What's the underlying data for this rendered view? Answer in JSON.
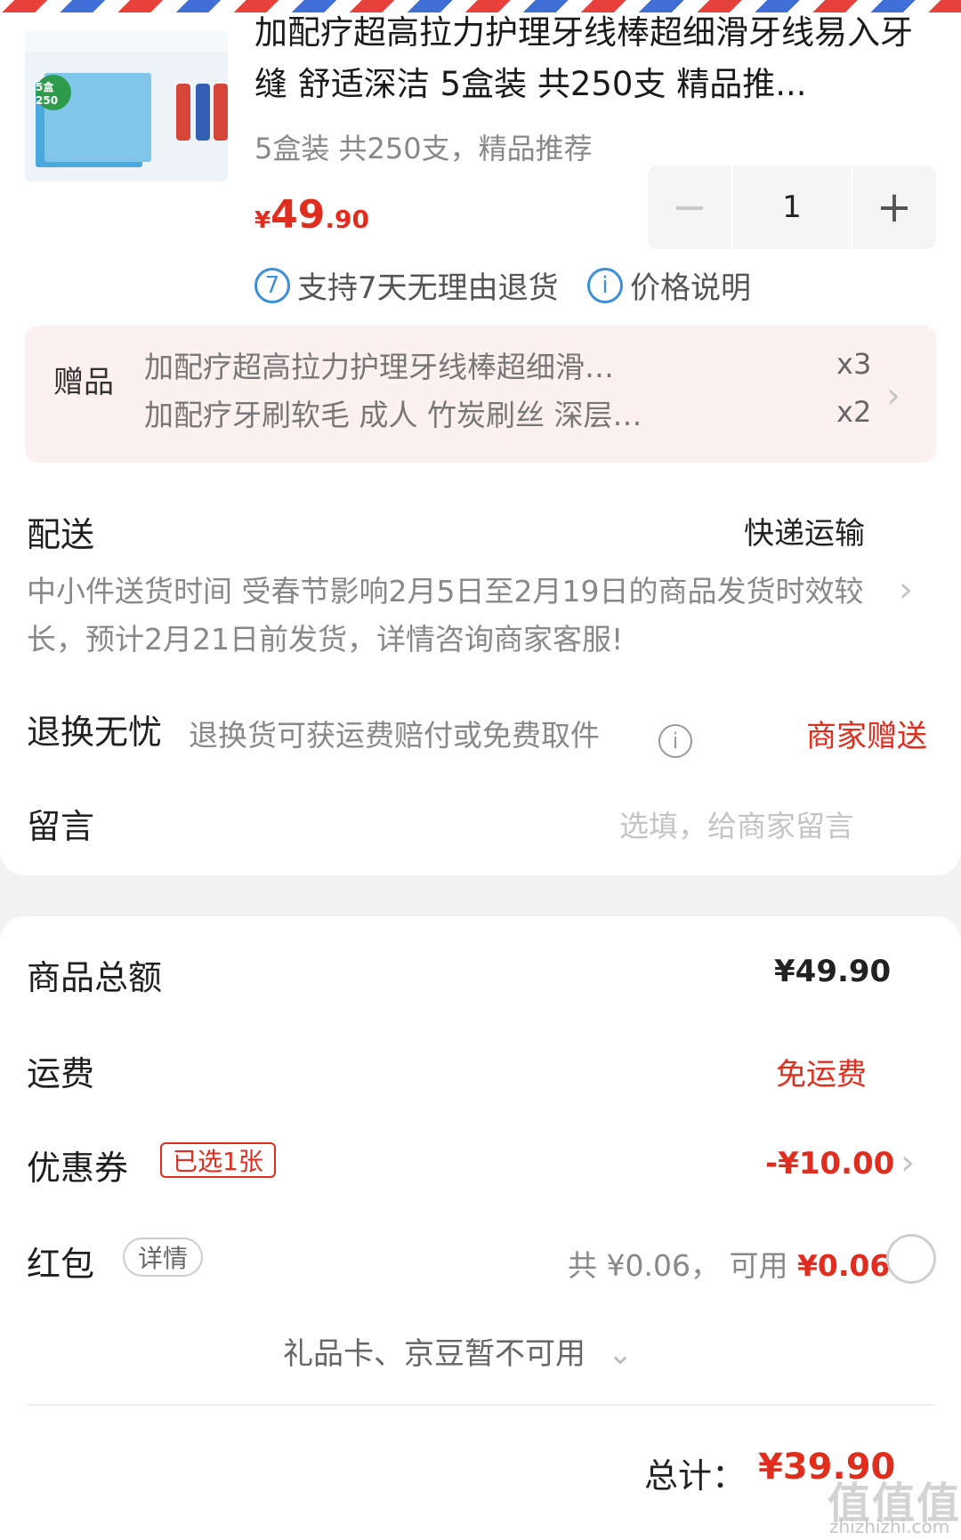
{
  "product": {
    "title": "加配疗超高拉力护理牙线棒超细滑牙线易入牙缝 舒适深洁 5盒装 共250支 精品推...",
    "spec": "5盒装 共250支，精品推荐",
    "price_symbol": "¥",
    "price_int": "49",
    "price_dec": ".90",
    "quantity": "1",
    "minus_label": "−",
    "plus_label": "+",
    "thumb_badge": "5盒 250"
  },
  "policies": [
    {
      "icon_text": "7",
      "text": "支持7天无理由退货"
    },
    {
      "icon_text": "i",
      "text": "价格说明"
    }
  ],
  "gifts": {
    "label": "赠品",
    "items": [
      {
        "name": "加配疗超高拉力护理牙线棒超细滑牙线易入牙...",
        "count": "x3"
      },
      {
        "name": "加配疗牙刷软毛 成人 竹炭刷丝 深层清洁减少...",
        "count": "x2"
      }
    ]
  },
  "delivery": {
    "label": "配送",
    "method": "快递运输",
    "note": "中小件送货时间  受春节影响2月5日至2月19日的商品发货时效较长，预计2月21日前发货，详情咨询商家客服!"
  },
  "return_service": {
    "label": "退换无忧",
    "desc": "退换货可获运费赔付或免费取件",
    "value": "商家赠送",
    "info_icon": "i"
  },
  "message": {
    "label": "留言",
    "placeholder": "选填，给商家留言"
  },
  "summary": {
    "goods_total_label": "商品总额",
    "goods_total_value": "¥49.90",
    "shipping_label": "运费",
    "shipping_value": "免运费",
    "coupon_label": "优惠券",
    "coupon_tag": "已选1张",
    "coupon_value": "-¥10.00",
    "redpacket_label": "红包",
    "redpacket_tag": "详情",
    "redpacket_total": "共 ¥0.06，",
    "redpacket_avail_label": "可用",
    "redpacket_avail_value": "¥0.06",
    "giftcard_text": "礼品卡、京豆暂不可用",
    "total_label": "总计：",
    "total_value": "¥39.90"
  },
  "watermark": {
    "text": "值值值",
    "url": "zhizhizhi.com"
  },
  "colors": {
    "accent_red": "#e02d1e",
    "info_blue": "#3b8fd9",
    "gift_bg": "#fdf0f0"
  }
}
